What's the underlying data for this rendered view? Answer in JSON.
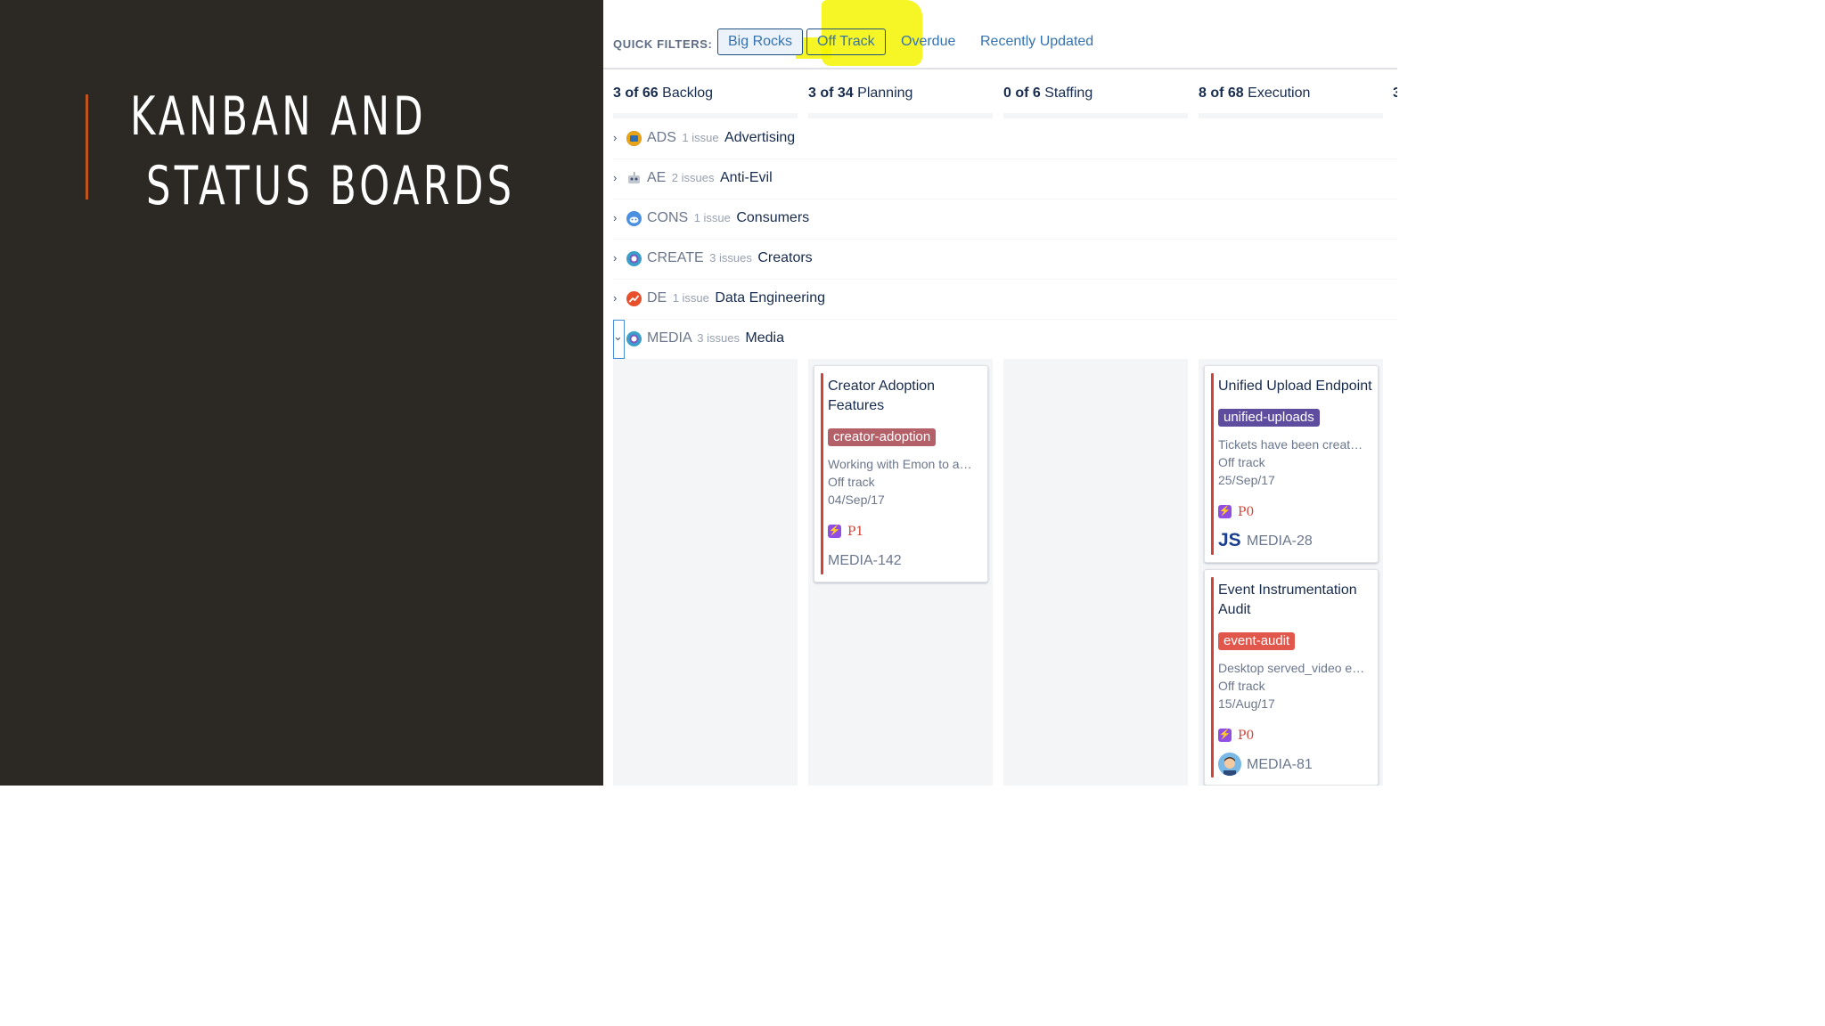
{
  "slide": {
    "title": "KANBAN AND\n STATUS BOARDS"
  },
  "colors": {
    "slide_bg": "#2c2924",
    "accent": "#c0541f",
    "highlight": "#f5f400",
    "card_bar": "#d04437",
    "link": "#3572b0"
  },
  "quick_filters": {
    "label": "QUICK FILTERS:",
    "items": [
      "Big Rocks",
      "Off Track",
      "Overdue",
      "Recently Updated"
    ]
  },
  "columns": [
    {
      "count": "3 of 66",
      "name": "Backlog"
    },
    {
      "count": "3 of 34",
      "name": "Planning"
    },
    {
      "count": "0 of 6",
      "name": "Staffing"
    },
    {
      "count": "8 of 68",
      "name": "Execution"
    },
    {
      "count": "3",
      "name": ""
    }
  ],
  "swimlanes": [
    {
      "key": "ADS",
      "count": "1 issue",
      "name": "Advertising",
      "icon": "folder-icon",
      "color": "#e8a317"
    },
    {
      "key": "AE",
      "count": "2 issues",
      "name": "Anti-Evil",
      "icon": "robot-icon",
      "color": "#9aa3ad"
    },
    {
      "key": "CONS",
      "count": "1 issue",
      "name": "Consumers",
      "icon": "alien-icon",
      "color": "#4a8fe0"
    },
    {
      "key": "CREATE",
      "count": "3 issues",
      "name": "Creators",
      "icon": "alien-icon",
      "color": "#3aa0c8"
    },
    {
      "key": "DE",
      "count": "1 issue",
      "name": "Data Engineering",
      "icon": "chart-icon",
      "color": "#e8502c"
    },
    {
      "key": "MEDIA",
      "count": "3 issues",
      "name": "Media",
      "icon": "alien-icon",
      "color": "#3aa0c8"
    }
  ],
  "cards": [
    {
      "title": "Creator Adoption Features",
      "epic": "creator-adoption",
      "epic_color": "#b46068",
      "summary": "Working with Emon to a…",
      "status": "Off track",
      "date": "04/Sep/17",
      "priority": "P1",
      "key": "MEDIA-142",
      "avatar": ""
    },
    {
      "title": "Unified Upload Endpoint",
      "epic": "unified-uploads",
      "epic_color": "#5e4d9e",
      "summary": "Tickets have been creat…",
      "status": "Off track",
      "date": "25/Sep/17",
      "priority": "P0",
      "key": "MEDIA-28",
      "avatar": "JS"
    },
    {
      "title": "Event Instrumentation Audit",
      "epic": "event-audit",
      "epic_color": "#e2574c",
      "summary": "Desktop served_video e…",
      "status": "Off track",
      "date": "15/Aug/17",
      "priority": "P0",
      "key": "MEDIA-81",
      "avatar": "user-face-icon"
    }
  ]
}
